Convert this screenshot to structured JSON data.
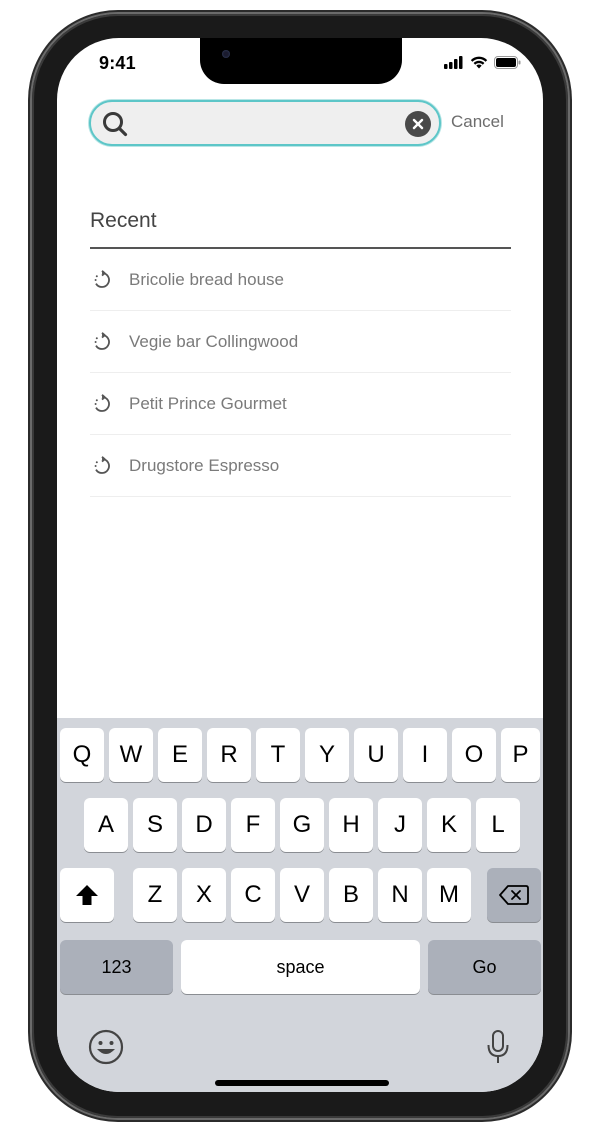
{
  "status_bar": {
    "time": "9:41",
    "icons": [
      "cellular-signal-icon",
      "wifi-icon",
      "battery-icon"
    ]
  },
  "search": {
    "value": "",
    "placeholder": "",
    "clear_icon": "clear-circle-icon",
    "cancel_label": "Cancel",
    "accent_color": "#5dc6c8"
  },
  "recent": {
    "title": "Recent",
    "items": [
      {
        "label": "Bricolie bread house",
        "icon": "history-icon"
      },
      {
        "label": "Vegie bar Collingwood",
        "icon": "history-icon"
      },
      {
        "label": "Petit Prince Gourmet",
        "icon": "history-icon"
      },
      {
        "label": "Drugstore Espresso",
        "icon": "history-icon"
      }
    ]
  },
  "keyboard": {
    "row1": [
      "Q",
      "W",
      "E",
      "R",
      "T",
      "Y",
      "U",
      "I",
      "O",
      "P"
    ],
    "row2": [
      "A",
      "S",
      "D",
      "F",
      "G",
      "H",
      "J",
      "K",
      "L"
    ],
    "row3": [
      "Z",
      "X",
      "C",
      "V",
      "B",
      "N",
      "M"
    ],
    "numbers_label": "123",
    "space_label": "space",
    "go_label": "Go",
    "shift_icon": "shift-icon",
    "backspace_icon": "backspace-icon",
    "emoji_icon": "emoji-icon",
    "mic_icon": "microphone-icon"
  }
}
